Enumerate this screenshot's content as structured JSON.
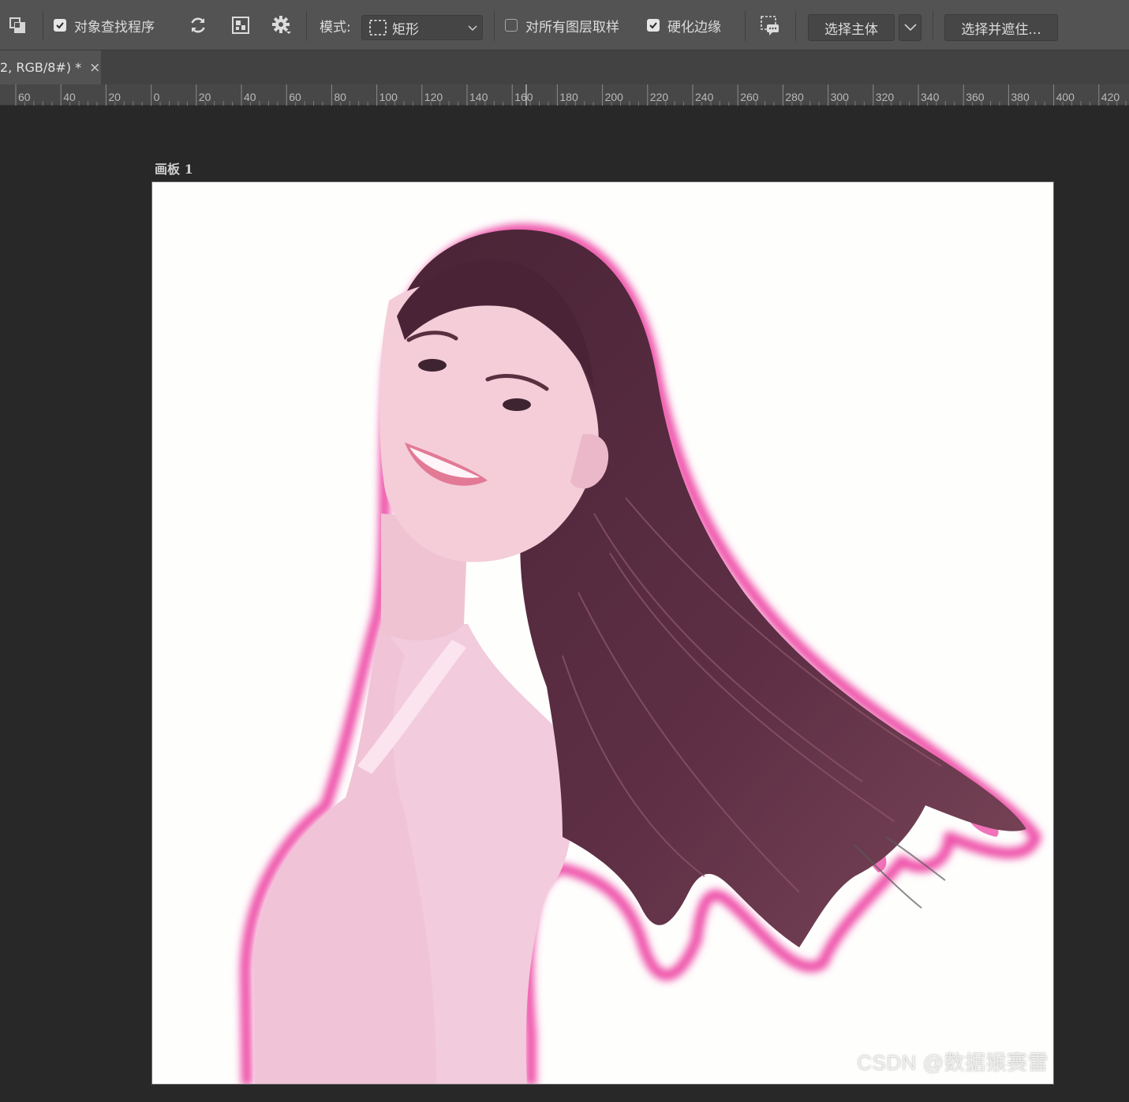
{
  "options_bar": {
    "object_finder_label": "对象查找程序",
    "object_finder_checked": true,
    "mode_label": "模式:",
    "mode_value": "矩形",
    "sample_all_layers_label": "对所有图层取样",
    "sample_all_layers_checked": false,
    "hard_edge_label": "硬化边缘",
    "hard_edge_checked": true,
    "select_subject_label": "选择主体",
    "select_and_mask_label": "选择并遮住..."
  },
  "tab": {
    "title": "2, RGB/8#) *",
    "close": "×"
  },
  "ruler": {
    "labels": [
      "60",
      "40",
      "20",
      "0",
      "20",
      "40",
      "60",
      "80",
      "100",
      "120",
      "140",
      "160",
      "180",
      "200",
      "220",
      "240",
      "260",
      "280",
      "300",
      "320",
      "340",
      "360",
      "380",
      "400",
      "420"
    ]
  },
  "artboard": {
    "label": "画板 1"
  },
  "watermark": "CSDN @数据猴赛雷",
  "colors": {
    "overlay_tint": "#f4cde0",
    "selection_glow": "#ee4fa8",
    "hair": "#5a2c40"
  }
}
